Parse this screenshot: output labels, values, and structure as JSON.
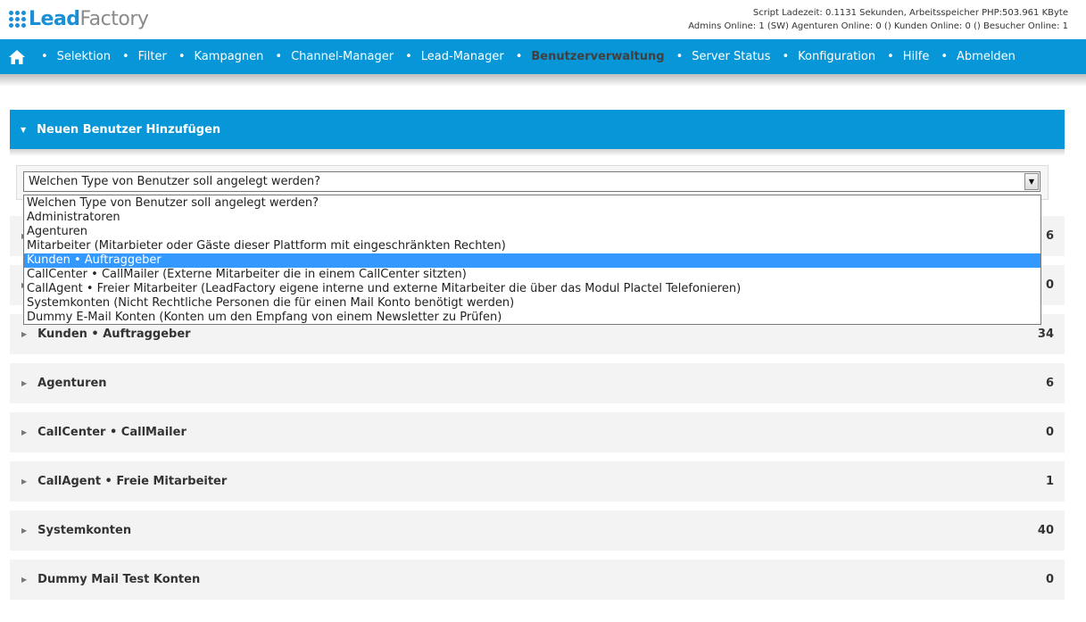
{
  "header": {
    "logo_lead": "Lead",
    "logo_factory": "Factory",
    "stats_line1": "Script Ladezeit: 0.1131 Sekunden, Arbeitsspeicher PHP:503.961 KByte",
    "stats_line2": "Admins Online: 1 (SW) Agenturen Online: 0 () Kunden Online: 0 () Besucher Online: 1"
  },
  "nav": {
    "bullet": "•",
    "items": [
      {
        "label": "Selektion"
      },
      {
        "label": "Filter"
      },
      {
        "label": "Kampagnen"
      },
      {
        "label": "Channel-Manager"
      },
      {
        "label": "Lead-Manager"
      },
      {
        "label": "Benutzerverwaltung"
      },
      {
        "label": "Server Status"
      },
      {
        "label": "Konfiguration"
      },
      {
        "label": "Hilfe"
      },
      {
        "label": "Abmelden"
      }
    ]
  },
  "add_panel": {
    "title": "Neuen Benutzer Hinzufügen"
  },
  "select": {
    "value": "Welchen Type von Benutzer soll angelegt werden?",
    "options": [
      "Welchen Type von Benutzer soll angelegt werden?",
      "Administratoren",
      "Agenturen",
      "Mitarbeiter (Mitarbieter oder Gäste dieser Plattform mit eingeschränkten Rechten)",
      "Kunden • Auftraggeber",
      "CallCenter • CallMailer (Externe Mitarbeiter die in einem CallCenter sitzten)",
      "CallAgent • Freier Mitarbeiter (LeadFactory eigene interne und externe Mitarbeiter die über das Modul Plactel Telefonieren)",
      "Systemkonten (Nicht Rechtliche Personen die für einen Mail Konto benötigt werden)",
      "Dummy E-Mail Konten (Konten um den Empfang von einem Newsletter zu Prüfen)"
    ]
  },
  "rows": [
    {
      "label": "",
      "count": "6"
    },
    {
      "label": "",
      "count": "0"
    },
    {
      "label": "Kunden • Auftraggeber",
      "count": "34"
    },
    {
      "label": "Agenturen",
      "count": "6"
    },
    {
      "label": "CallCenter • CallMailer",
      "count": "0"
    },
    {
      "label": "CallAgent • Freie Mitarbeiter",
      "count": "1"
    },
    {
      "label": "Systemkonten",
      "count": "40"
    },
    {
      "label": "Dummy Mail Test Konten",
      "count": "0"
    }
  ],
  "colors": {
    "brand_blue": "#0797d8",
    "active_nav_text": "#404040",
    "selection_blue": "#3399ff"
  },
  "icons": {
    "home": "home-icon",
    "caret_down": "caret-down-icon",
    "caret_right": "caret-right-icon",
    "select_arrow": "chevron-down-icon"
  }
}
